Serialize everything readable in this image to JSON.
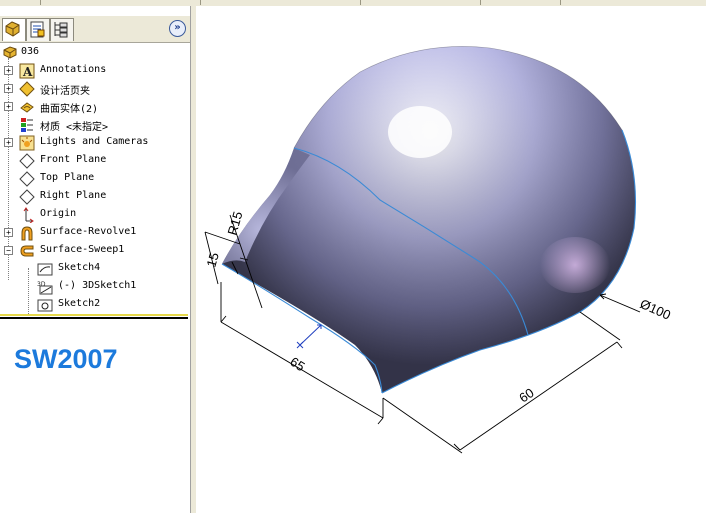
{
  "tree": {
    "root": "036",
    "items": [
      {
        "label": "Annotations",
        "icon": "annotations-icon"
      },
      {
        "label": "设计活页夹",
        "icon": "design-binder-icon"
      },
      {
        "label": "曲面实体(2)",
        "icon": "surface-bodies-icon"
      },
      {
        "label": "材质 <未指定>",
        "icon": "material-icon"
      },
      {
        "label": "Lights and Cameras",
        "icon": "lights-icon"
      },
      {
        "label": "Front Plane",
        "icon": "plane-icon"
      },
      {
        "label": "Top Plane",
        "icon": "plane-icon"
      },
      {
        "label": "Right Plane",
        "icon": "plane-icon"
      },
      {
        "label": "Origin",
        "icon": "origin-icon"
      },
      {
        "label": "Surface-Revolve1",
        "icon": "revolve-icon"
      },
      {
        "label": "Surface-Sweep1",
        "icon": "sweep-icon"
      }
    ],
    "children": [
      {
        "label": "Sketch4",
        "icon": "sketch-icon"
      },
      {
        "label": "(-) 3DSketch1",
        "icon": "3d-sketch-icon"
      },
      {
        "label": "Sketch2",
        "icon": "sketch-icon"
      }
    ]
  },
  "version_label": "SW2007",
  "dimensions": {
    "r15": "R15",
    "d15": "15",
    "d65": "65",
    "d60": "60",
    "dia100": "Ø100"
  },
  "colors": {
    "accent": "#1c7adc",
    "surface_light": "#e4e4fb",
    "surface_dark": "#4a4a6a",
    "edge": "#3a8ad6"
  }
}
